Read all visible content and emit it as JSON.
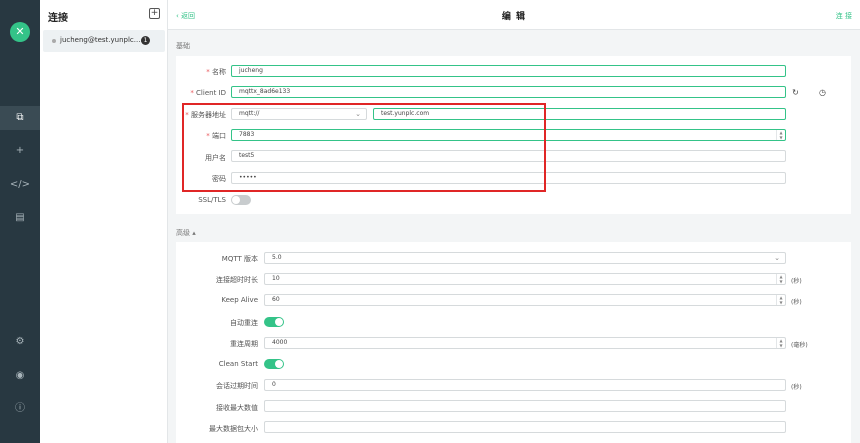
{
  "rail": {
    "logo_glyph": "✕",
    "icons": [
      "connections-icon",
      "add-icon",
      "script-icon",
      "log-icon",
      "settings-icon",
      "feed-icon",
      "info-icon"
    ]
  },
  "sidebar": {
    "title": "连接",
    "add_glyph": "+",
    "connection": {
      "name": "jucheng@test.yunplc....",
      "badge": "1"
    }
  },
  "topbar": {
    "back": "‹ 返回",
    "title": "编 辑",
    "save": "连 接"
  },
  "general": {
    "section": "基础",
    "name_label": "名称",
    "name_value": "jucheng",
    "client_id_label": "Client ID",
    "client_id_value": "mqttx_8ad6e133",
    "host_label": "服务器地址",
    "protocol_value": "mqtt://",
    "host_value": "test.yunplc.com",
    "port_label": "端口",
    "port_value": "7883",
    "username_label": "用户名",
    "username_value": "test5",
    "password_label": "密码",
    "password_value": "•••••",
    "ssl_label": "SSL/TLS"
  },
  "advanced": {
    "section": "高级 ▴",
    "mqtt_version_label": "MQTT 版本",
    "mqtt_version_value": "5.0",
    "connect_timeout_label": "连接超时时长",
    "connect_timeout_value": "10",
    "connect_timeout_unit": "(秒)",
    "keepalive_label": "Keep Alive",
    "keepalive_value": "60",
    "keepalive_unit": "(秒)",
    "auto_reconnect_label": "自动重连",
    "reconnect_period_label": "重连周期",
    "reconnect_period_value": "4000",
    "reconnect_period_unit": "(毫秒)",
    "clean_start_label": "Clean Start",
    "session_expiry_label": "会话过期时间",
    "session_expiry_value": "0",
    "session_expiry_unit": "(秒)",
    "receive_max_label": "接收最大数值",
    "max_packet_label": "最大数据包大小"
  },
  "colors": {
    "accent": "#34c388",
    "highlight": "#e02626",
    "rail": "#283841"
  }
}
